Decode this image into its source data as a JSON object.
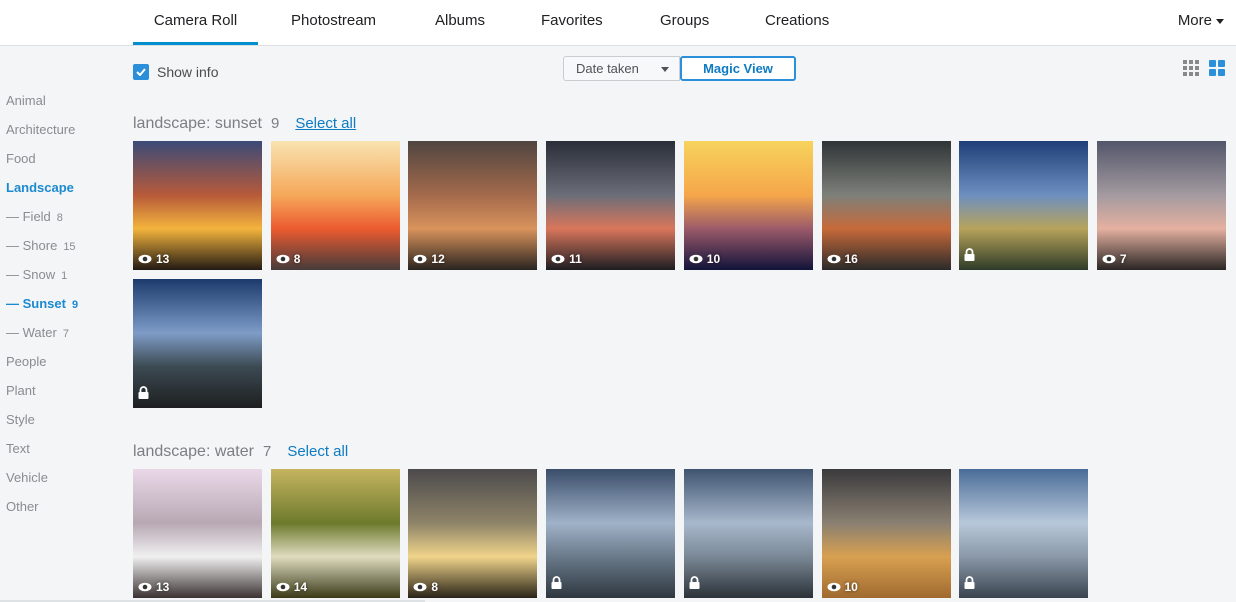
{
  "nav": {
    "tabs": [
      {
        "label": "Camera Roll",
        "active": true
      },
      {
        "label": "Photostream"
      },
      {
        "label": "Albums"
      },
      {
        "label": "Favorites"
      },
      {
        "label": "Groups"
      },
      {
        "label": "Creations"
      }
    ],
    "more_label": "More"
  },
  "toolbar": {
    "show_info_label": "Show info",
    "show_info_checked": true,
    "sort_label": "Date taken",
    "magic_view_label": "Magic View",
    "view_icons": [
      "small-grid-icon",
      "large-grid-icon"
    ],
    "accent_color": "#2b8fd9"
  },
  "sidebar": {
    "items": [
      {
        "label": "Animal"
      },
      {
        "label": "Architecture"
      },
      {
        "label": "Food"
      },
      {
        "label": "Landscape",
        "active": true
      },
      {
        "label": "— Field",
        "count": "8",
        "sub": true
      },
      {
        "label": "— Shore",
        "count": "15",
        "sub": true
      },
      {
        "label": "— Snow",
        "count": "1",
        "sub": true
      },
      {
        "label": "— Sunset",
        "count": "9",
        "sub": true,
        "active": true
      },
      {
        "label": "— Water",
        "count": "7",
        "sub": true
      },
      {
        "label": "People"
      },
      {
        "label": "Plant"
      },
      {
        "label": "Style"
      },
      {
        "label": "Text"
      },
      {
        "label": "Vehicle"
      },
      {
        "label": "Other"
      }
    ]
  },
  "sections": [
    {
      "title": "landscape: sunset",
      "count": "9",
      "select_label": "Select all",
      "photos": [
        {
          "views": "13",
          "palette": [
            "#3b4b78",
            "#b75a3a",
            "#f3b43c",
            "#231a14"
          ]
        },
        {
          "views": "8",
          "palette": [
            "#f8e3b0",
            "#f5a85a",
            "#ec5b30",
            "#463b3b"
          ]
        },
        {
          "views": "12",
          "palette": [
            "#4f4540",
            "#a46a4c",
            "#d9935c",
            "#2a2420"
          ]
        },
        {
          "views": "11",
          "palette": [
            "#2a2e38",
            "#6b6e78",
            "#d9765c",
            "#1d1d22"
          ]
        },
        {
          "views": "10",
          "palette": [
            "#f7d35c",
            "#f5a64a",
            "#9b5a6a",
            "#12133a"
          ]
        },
        {
          "views": "16",
          "palette": [
            "#2f3436",
            "#7d807a",
            "#c76a3a",
            "#2a2a2a"
          ]
        },
        {
          "views": "",
          "locked": true,
          "palette": [
            "#1e3f78",
            "#6d8fc0",
            "#b7a35a",
            "#2d3b28"
          ]
        },
        {
          "views": "7",
          "palette": [
            "#52566a",
            "#a49aa0",
            "#e4b0a0",
            "#2a2624"
          ]
        },
        {
          "views": "",
          "locked": true,
          "palette": [
            "#1c3a6c",
            "#7e9cc7",
            "#3c4a52",
            "#1d1f20"
          ]
        }
      ]
    },
    {
      "title": "landscape: water",
      "count": "7",
      "select_label": "Select all",
      "photos": [
        {
          "views": "13",
          "palette": [
            "#ead8e8",
            "#b8a8b4",
            "#f0f0f0",
            "#3b3232"
          ]
        },
        {
          "views": "14",
          "palette": [
            "#c6b460",
            "#6d7a2c",
            "#e0dcc0",
            "#3a3a18"
          ]
        },
        {
          "views": "8",
          "palette": [
            "#4c4a4c",
            "#8e8468",
            "#f0d48a",
            "#2a2418"
          ]
        },
        {
          "views": "",
          "locked": true,
          "palette": [
            "#3a4d6a",
            "#a0b2c8",
            "#6a7a8a",
            "#2e3740"
          ]
        },
        {
          "views": "",
          "locked": true,
          "palette": [
            "#3f5470",
            "#a8b8cc",
            "#7a8896",
            "#2b3238"
          ]
        },
        {
          "views": "10",
          "palette": [
            "#3a3a3c",
            "#8a8072",
            "#d8a050",
            "#a06a30"
          ]
        },
        {
          "views": "",
          "locked": true,
          "palette": [
            "#4a6c98",
            "#b8c8da",
            "#8a98a8",
            "#3a4450"
          ]
        }
      ]
    }
  ]
}
